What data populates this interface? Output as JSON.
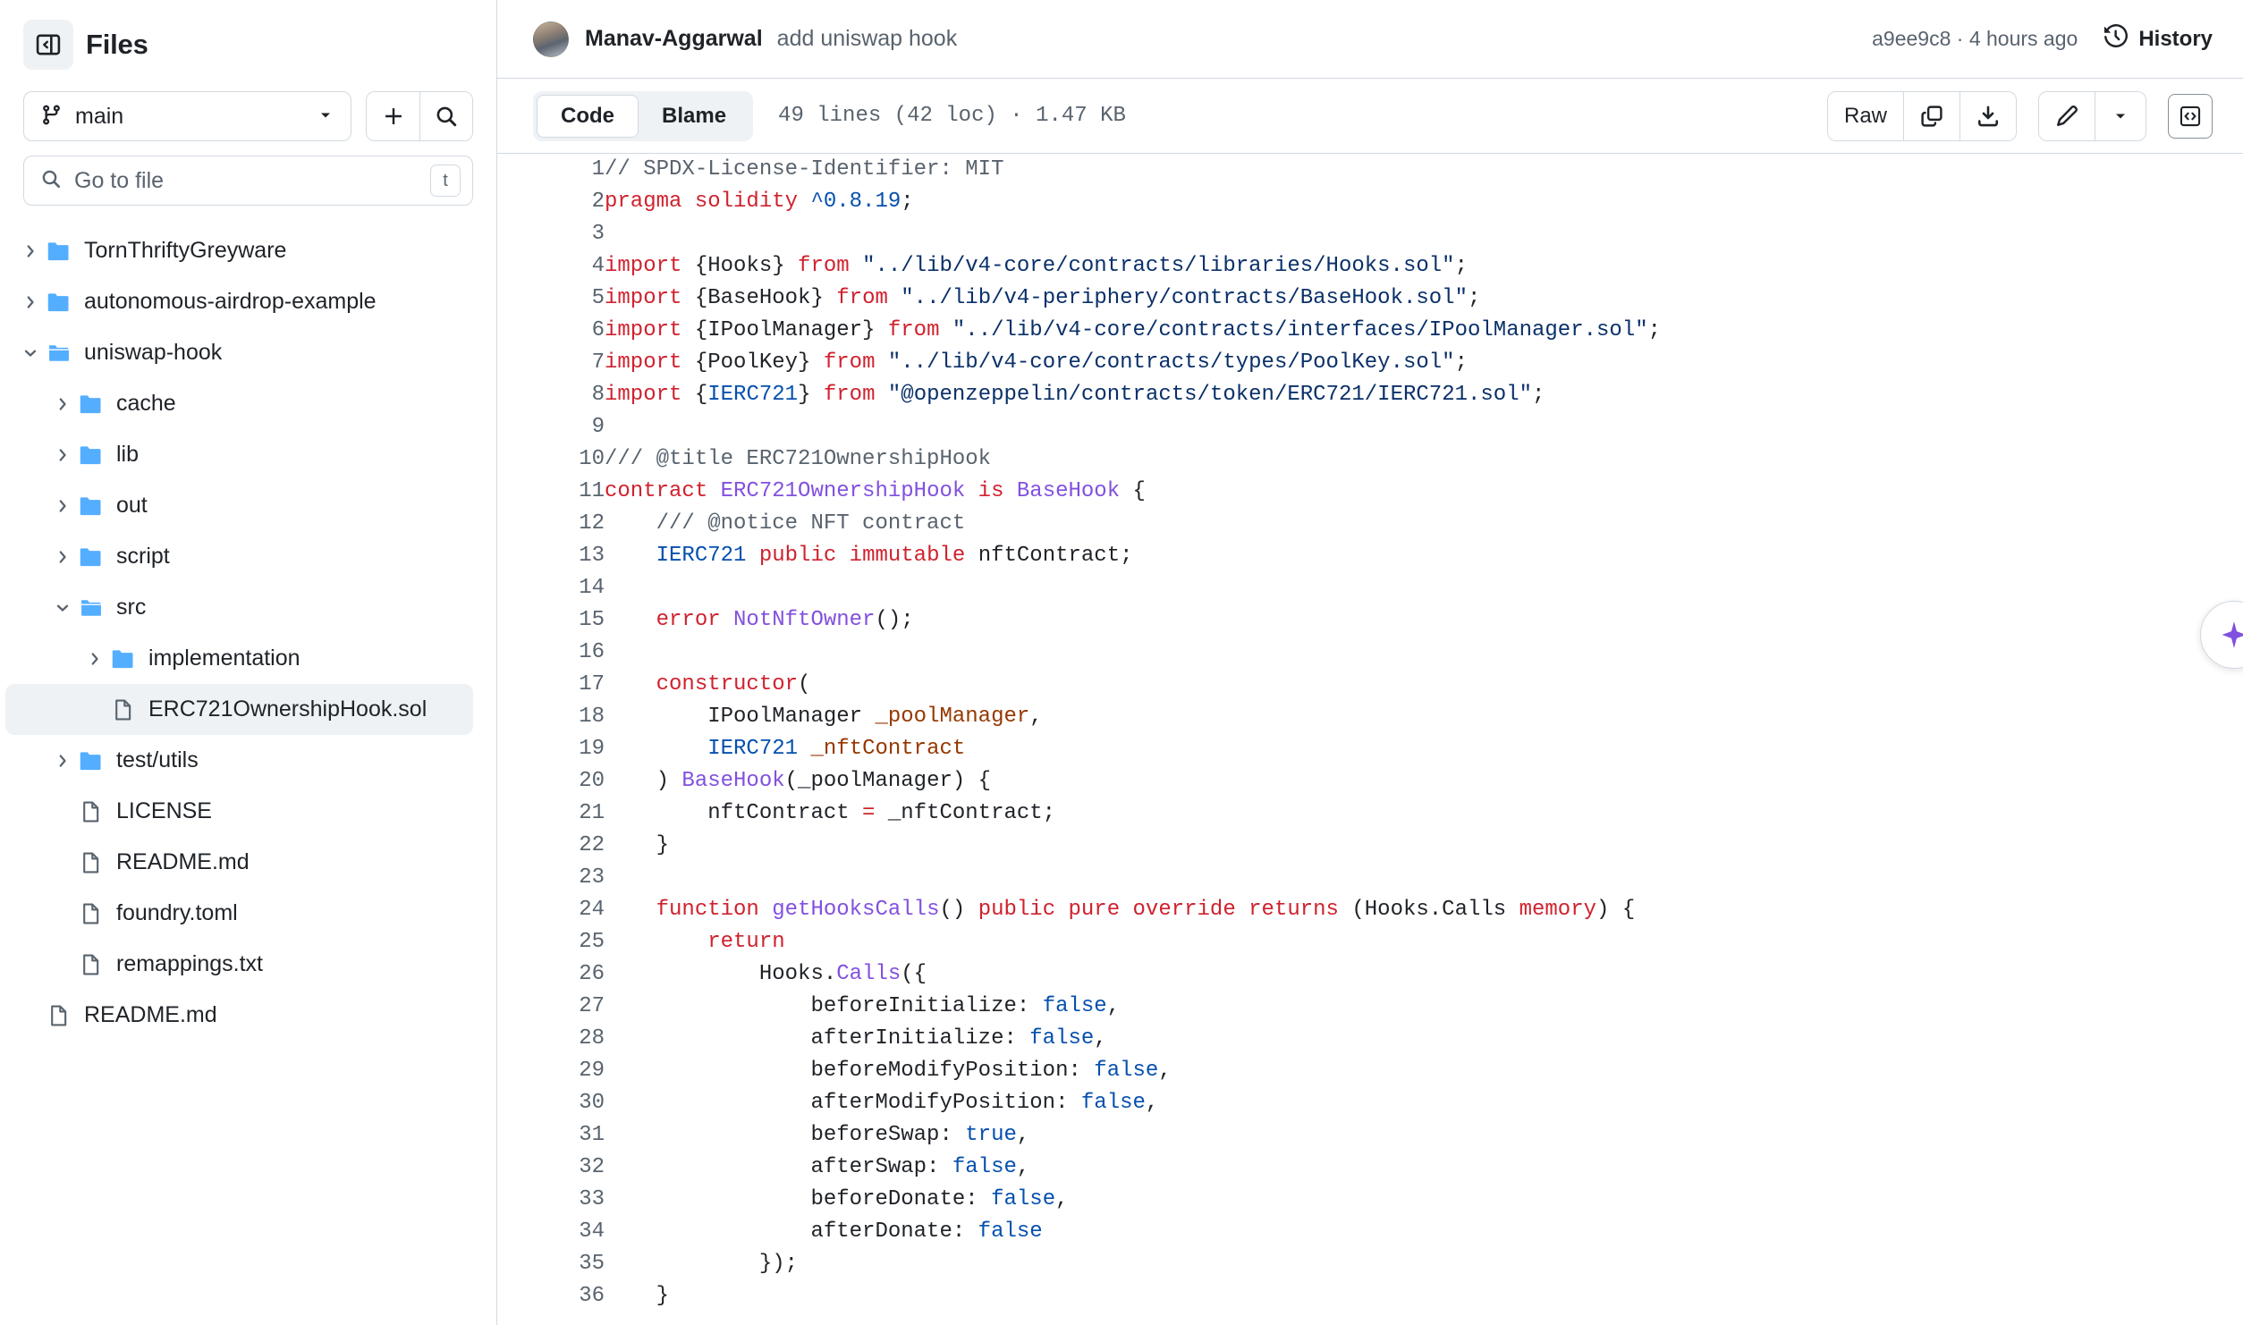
{
  "sidebar": {
    "title": "Files",
    "panel_toggle_icon": "sidebar-collapse-icon",
    "branch": {
      "name": "main",
      "icon": "git-branch-icon",
      "chevron_icon": "chevron-down-icon"
    },
    "add_button_icon": "plus-icon",
    "search_button_icon": "search-icon",
    "file_search": {
      "placeholder": "Go to file",
      "value": "",
      "icon": "search-icon",
      "shortcut": "t"
    },
    "tree": [
      {
        "label": "TornThriftyGreyware",
        "type": "folder",
        "depth": 0,
        "state": "collapsed",
        "selected": false
      },
      {
        "label": "autonomous-airdrop-example",
        "type": "folder",
        "depth": 0,
        "state": "collapsed",
        "selected": false
      },
      {
        "label": "uniswap-hook",
        "type": "folder",
        "depth": 0,
        "state": "expanded",
        "selected": false
      },
      {
        "label": "cache",
        "type": "folder",
        "depth": 1,
        "state": "collapsed",
        "selected": false
      },
      {
        "label": "lib",
        "type": "folder",
        "depth": 1,
        "state": "collapsed",
        "selected": false
      },
      {
        "label": "out",
        "type": "folder",
        "depth": 1,
        "state": "collapsed",
        "selected": false
      },
      {
        "label": "script",
        "type": "folder",
        "depth": 1,
        "state": "collapsed",
        "selected": false
      },
      {
        "label": "src",
        "type": "folder",
        "depth": 1,
        "state": "expanded",
        "selected": false
      },
      {
        "label": "implementation",
        "type": "folder",
        "depth": 2,
        "state": "collapsed",
        "selected": false
      },
      {
        "label": "ERC721OwnershipHook.sol",
        "type": "file",
        "depth": 2,
        "state": "none",
        "selected": true
      },
      {
        "label": "test/utils",
        "type": "folder",
        "depth": 1,
        "state": "collapsed",
        "selected": false
      },
      {
        "label": "LICENSE",
        "type": "file",
        "depth": 1,
        "state": "none",
        "selected": false
      },
      {
        "label": "README.md",
        "type": "file",
        "depth": 1,
        "state": "none",
        "selected": false
      },
      {
        "label": "foundry.toml",
        "type": "file",
        "depth": 1,
        "state": "none",
        "selected": false
      },
      {
        "label": "remappings.txt",
        "type": "file",
        "depth": 1,
        "state": "none",
        "selected": false
      },
      {
        "label": "README.md",
        "type": "file",
        "depth": 0,
        "state": "none",
        "selected": false
      }
    ]
  },
  "commit_bar": {
    "author": "Manav-Aggarwal",
    "message": "add uniswap hook",
    "sha": "a9ee9c8",
    "separator": "·",
    "relative_time": "4 hours ago",
    "meta": "a9ee9c8 · 4 hours ago",
    "history_label": "History",
    "history_icon": "clock-history-icon",
    "avatar_icon": "avatar"
  },
  "file_toolbar": {
    "tabs": [
      {
        "label": "Code",
        "active": true
      },
      {
        "label": "Blame",
        "active": false
      }
    ],
    "file_meta": "49 lines (42 loc) · 1.47 KB",
    "lines_count": "49 lines",
    "loc_count": "(42 loc)",
    "file_size": "1.47 KB",
    "raw_label": "Raw",
    "copy_icon": "copy-icon",
    "download_icon": "download-icon",
    "edit_icon": "pencil-icon",
    "edit_menu_icon": "chevron-down-icon",
    "symbols_icon": "code-symbols-icon"
  },
  "copilot": {
    "icon": "copilot-sparkle-icon",
    "color": "#8250df"
  },
  "code": {
    "language": "solidity",
    "lines": [
      {
        "n": 1,
        "tokens": [
          {
            "t": "// SPDX-License-Identifier: MIT",
            "c": "c"
          }
        ]
      },
      {
        "n": 2,
        "tokens": [
          {
            "t": "pragma solidity ",
            "c": "k"
          },
          {
            "t": "^0.8.19",
            "c": "n"
          },
          {
            "t": ";",
            "c": ""
          }
        ]
      },
      {
        "n": 3,
        "tokens": []
      },
      {
        "n": 4,
        "tokens": [
          {
            "t": "import ",
            "c": "k"
          },
          {
            "t": "{Hooks} ",
            "c": ""
          },
          {
            "t": "from ",
            "c": "k"
          },
          {
            "t": "\"../lib/v4-core/contracts/libraries/Hooks.sol\"",
            "c": "s"
          },
          {
            "t": ";",
            "c": ""
          }
        ]
      },
      {
        "n": 5,
        "tokens": [
          {
            "t": "import ",
            "c": "k"
          },
          {
            "t": "{BaseHook} ",
            "c": ""
          },
          {
            "t": "from ",
            "c": "k"
          },
          {
            "t": "\"../lib/v4-periphery/contracts/BaseHook.sol\"",
            "c": "s"
          },
          {
            "t": ";",
            "c": ""
          }
        ]
      },
      {
        "n": 6,
        "tokens": [
          {
            "t": "import ",
            "c": "k"
          },
          {
            "t": "{IPoolManager} ",
            "c": ""
          },
          {
            "t": "from ",
            "c": "k"
          },
          {
            "t": "\"../lib/v4-core/contracts/interfaces/IPoolManager.sol\"",
            "c": "s"
          },
          {
            "t": ";",
            "c": ""
          }
        ]
      },
      {
        "n": 7,
        "tokens": [
          {
            "t": "import ",
            "c": "k"
          },
          {
            "t": "{PoolKey} ",
            "c": ""
          },
          {
            "t": "from ",
            "c": "k"
          },
          {
            "t": "\"../lib/v4-core/contracts/types/PoolKey.sol\"",
            "c": "s"
          },
          {
            "t": ";",
            "c": ""
          }
        ]
      },
      {
        "n": 8,
        "tokens": [
          {
            "t": "import ",
            "c": "k"
          },
          {
            "t": "{",
            "c": ""
          },
          {
            "t": "IERC721",
            "c": "n"
          },
          {
            "t": "} ",
            "c": ""
          },
          {
            "t": "from ",
            "c": "k"
          },
          {
            "t": "\"@openzeppelin/contracts/token/ERC721/IERC721.sol\"",
            "c": "s"
          },
          {
            "t": ";",
            "c": ""
          }
        ]
      },
      {
        "n": 9,
        "tokens": []
      },
      {
        "n": 10,
        "tokens": [
          {
            "t": "/// @title ERC721OwnershipHook",
            "c": "c"
          }
        ]
      },
      {
        "n": 11,
        "tokens": [
          {
            "t": "contract ",
            "c": "k"
          },
          {
            "t": "ERC721OwnershipHook ",
            "c": "t"
          },
          {
            "t": "is ",
            "c": "k"
          },
          {
            "t": "BaseHook",
            "c": "t"
          },
          {
            "t": " {",
            "c": ""
          }
        ]
      },
      {
        "n": 12,
        "tokens": [
          {
            "t": "    /// @notice NFT contract",
            "c": "c"
          }
        ]
      },
      {
        "n": 13,
        "tokens": [
          {
            "t": "    ",
            "c": ""
          },
          {
            "t": "IERC721",
            "c": "n"
          },
          {
            "t": " ",
            "c": ""
          },
          {
            "t": "public immutable ",
            "c": "k"
          },
          {
            "t": "nftContract;",
            "c": ""
          }
        ]
      },
      {
        "n": 14,
        "tokens": []
      },
      {
        "n": 15,
        "tokens": [
          {
            "t": "    ",
            "c": ""
          },
          {
            "t": "error ",
            "c": "k"
          },
          {
            "t": "NotNftOwner",
            "c": "t"
          },
          {
            "t": "();",
            "c": ""
          }
        ]
      },
      {
        "n": 16,
        "tokens": []
      },
      {
        "n": 17,
        "tokens": [
          {
            "t": "    ",
            "c": ""
          },
          {
            "t": "constructor",
            "c": "k"
          },
          {
            "t": "(",
            "c": ""
          }
        ]
      },
      {
        "n": 18,
        "tokens": [
          {
            "t": "        IPoolManager ",
            "c": ""
          },
          {
            "t": "_poolManager",
            "c": "p"
          },
          {
            "t": ",",
            "c": ""
          }
        ]
      },
      {
        "n": 19,
        "tokens": [
          {
            "t": "        ",
            "c": ""
          },
          {
            "t": "IERC721",
            "c": "n"
          },
          {
            "t": " ",
            "c": ""
          },
          {
            "t": "_nftContract",
            "c": "p"
          }
        ]
      },
      {
        "n": 20,
        "tokens": [
          {
            "t": "    ) ",
            "c": ""
          },
          {
            "t": "BaseHook",
            "c": "t"
          },
          {
            "t": "(_poolManager) {",
            "c": ""
          }
        ]
      },
      {
        "n": 21,
        "tokens": [
          {
            "t": "        nftContract ",
            "c": ""
          },
          {
            "t": "=",
            "c": "k"
          },
          {
            "t": " _nftContract;",
            "c": ""
          }
        ]
      },
      {
        "n": 22,
        "tokens": [
          {
            "t": "    }",
            "c": ""
          }
        ]
      },
      {
        "n": 23,
        "tokens": []
      },
      {
        "n": 24,
        "tokens": [
          {
            "t": "    ",
            "c": ""
          },
          {
            "t": "function ",
            "c": "k"
          },
          {
            "t": "getHooksCalls",
            "c": "t"
          },
          {
            "t": "() ",
            "c": ""
          },
          {
            "t": "public pure override returns ",
            "c": "k"
          },
          {
            "t": "(Hooks.Calls ",
            "c": ""
          },
          {
            "t": "memory",
            "c": "k"
          },
          {
            "t": ") {",
            "c": ""
          }
        ]
      },
      {
        "n": 25,
        "tokens": [
          {
            "t": "        ",
            "c": ""
          },
          {
            "t": "return",
            "c": "k"
          }
        ]
      },
      {
        "n": 26,
        "tokens": [
          {
            "t": "            Hooks.",
            "c": ""
          },
          {
            "t": "Calls",
            "c": "t"
          },
          {
            "t": "({",
            "c": ""
          }
        ]
      },
      {
        "n": 27,
        "tokens": [
          {
            "t": "                beforeInitialize: ",
            "c": ""
          },
          {
            "t": "false",
            "c": "n"
          },
          {
            "t": ",",
            "c": ""
          }
        ]
      },
      {
        "n": 28,
        "tokens": [
          {
            "t": "                afterInitialize: ",
            "c": ""
          },
          {
            "t": "false",
            "c": "n"
          },
          {
            "t": ",",
            "c": ""
          }
        ]
      },
      {
        "n": 29,
        "tokens": [
          {
            "t": "                beforeModifyPosition: ",
            "c": ""
          },
          {
            "t": "false",
            "c": "n"
          },
          {
            "t": ",",
            "c": ""
          }
        ]
      },
      {
        "n": 30,
        "tokens": [
          {
            "t": "                afterModifyPosition: ",
            "c": ""
          },
          {
            "t": "false",
            "c": "n"
          },
          {
            "t": ",",
            "c": ""
          }
        ]
      },
      {
        "n": 31,
        "tokens": [
          {
            "t": "                beforeSwap: ",
            "c": ""
          },
          {
            "t": "true",
            "c": "n"
          },
          {
            "t": ",",
            "c": ""
          }
        ]
      },
      {
        "n": 32,
        "tokens": [
          {
            "t": "                afterSwap: ",
            "c": ""
          },
          {
            "t": "false",
            "c": "n"
          },
          {
            "t": ",",
            "c": ""
          }
        ]
      },
      {
        "n": 33,
        "tokens": [
          {
            "t": "                beforeDonate: ",
            "c": ""
          },
          {
            "t": "false",
            "c": "n"
          },
          {
            "t": ",",
            "c": ""
          }
        ]
      },
      {
        "n": 34,
        "tokens": [
          {
            "t": "                afterDonate: ",
            "c": ""
          },
          {
            "t": "false",
            "c": "n"
          }
        ]
      },
      {
        "n": 35,
        "tokens": [
          {
            "t": "            });",
            "c": ""
          }
        ]
      },
      {
        "n": 36,
        "tokens": [
          {
            "t": "    }",
            "c": ""
          }
        ]
      }
    ]
  }
}
